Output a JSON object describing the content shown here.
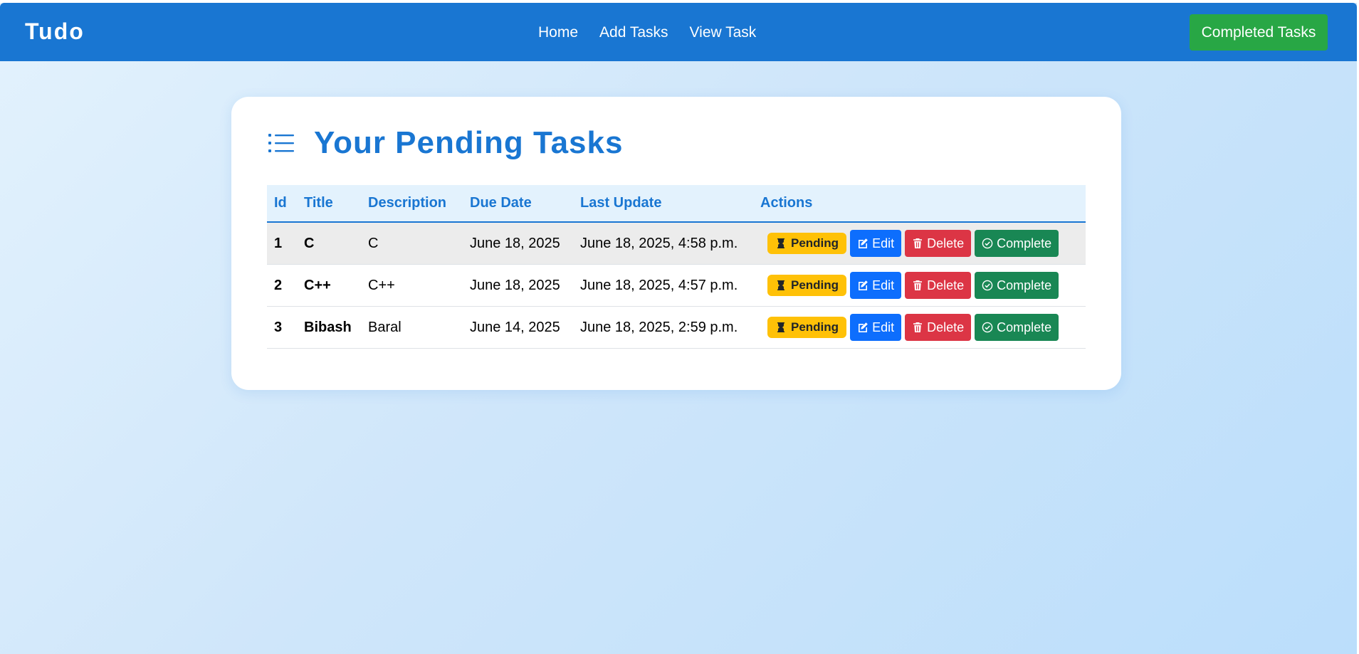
{
  "navbar": {
    "brand": "Tudo",
    "links": [
      "Home",
      "Add Tasks",
      "View Task"
    ],
    "completed_button": "Completed Tasks"
  },
  "card": {
    "title": "Your Pending Tasks",
    "icon": "list-icon"
  },
  "table": {
    "headers": [
      "Id",
      "Title",
      "Description",
      "Due Date",
      "Last Update",
      "Actions"
    ],
    "rows": [
      {
        "id": "1",
        "title": "C",
        "description": "C",
        "due_date": "June 18, 2025",
        "last_update": "June 18, 2025, 4:58 p.m.",
        "status": "Pending",
        "edit": "Edit",
        "delete": "Delete",
        "complete": "Complete"
      },
      {
        "id": "2",
        "title": "C++",
        "description": "C++",
        "due_date": "June 18, 2025",
        "last_update": "June 18, 2025, 4:57 p.m.",
        "status": "Pending",
        "edit": "Edit",
        "delete": "Delete",
        "complete": "Complete"
      },
      {
        "id": "3",
        "title": "Bibash",
        "description": "Baral",
        "due_date": "June 14, 2025",
        "last_update": "June 18, 2025, 2:59 p.m.",
        "status": "Pending",
        "edit": "Edit",
        "delete": "Delete",
        "complete": "Complete"
      }
    ]
  },
  "colors": {
    "primary": "#1976d2",
    "success": "#28a745",
    "warning": "#ffc107",
    "edit": "#0d6efd",
    "danger": "#dc3545",
    "complete": "#198754"
  }
}
